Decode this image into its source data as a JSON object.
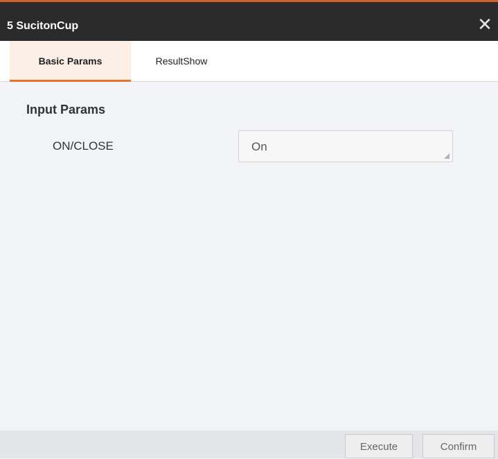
{
  "window": {
    "title": "5 SucitonCup",
    "close_glyph": "✕",
    "accent_color": "#e8752c",
    "titlebar_color": "#2b2b2b"
  },
  "tabs": [
    {
      "label": "Basic Params",
      "active": true
    },
    {
      "label": "ResultShow",
      "active": false
    }
  ],
  "section": {
    "title": "Input Params",
    "params": [
      {
        "label": "ON/CLOSE",
        "value": "On"
      }
    ]
  },
  "footer": {
    "execute_label": "Execute",
    "confirm_label": "Confirm"
  }
}
